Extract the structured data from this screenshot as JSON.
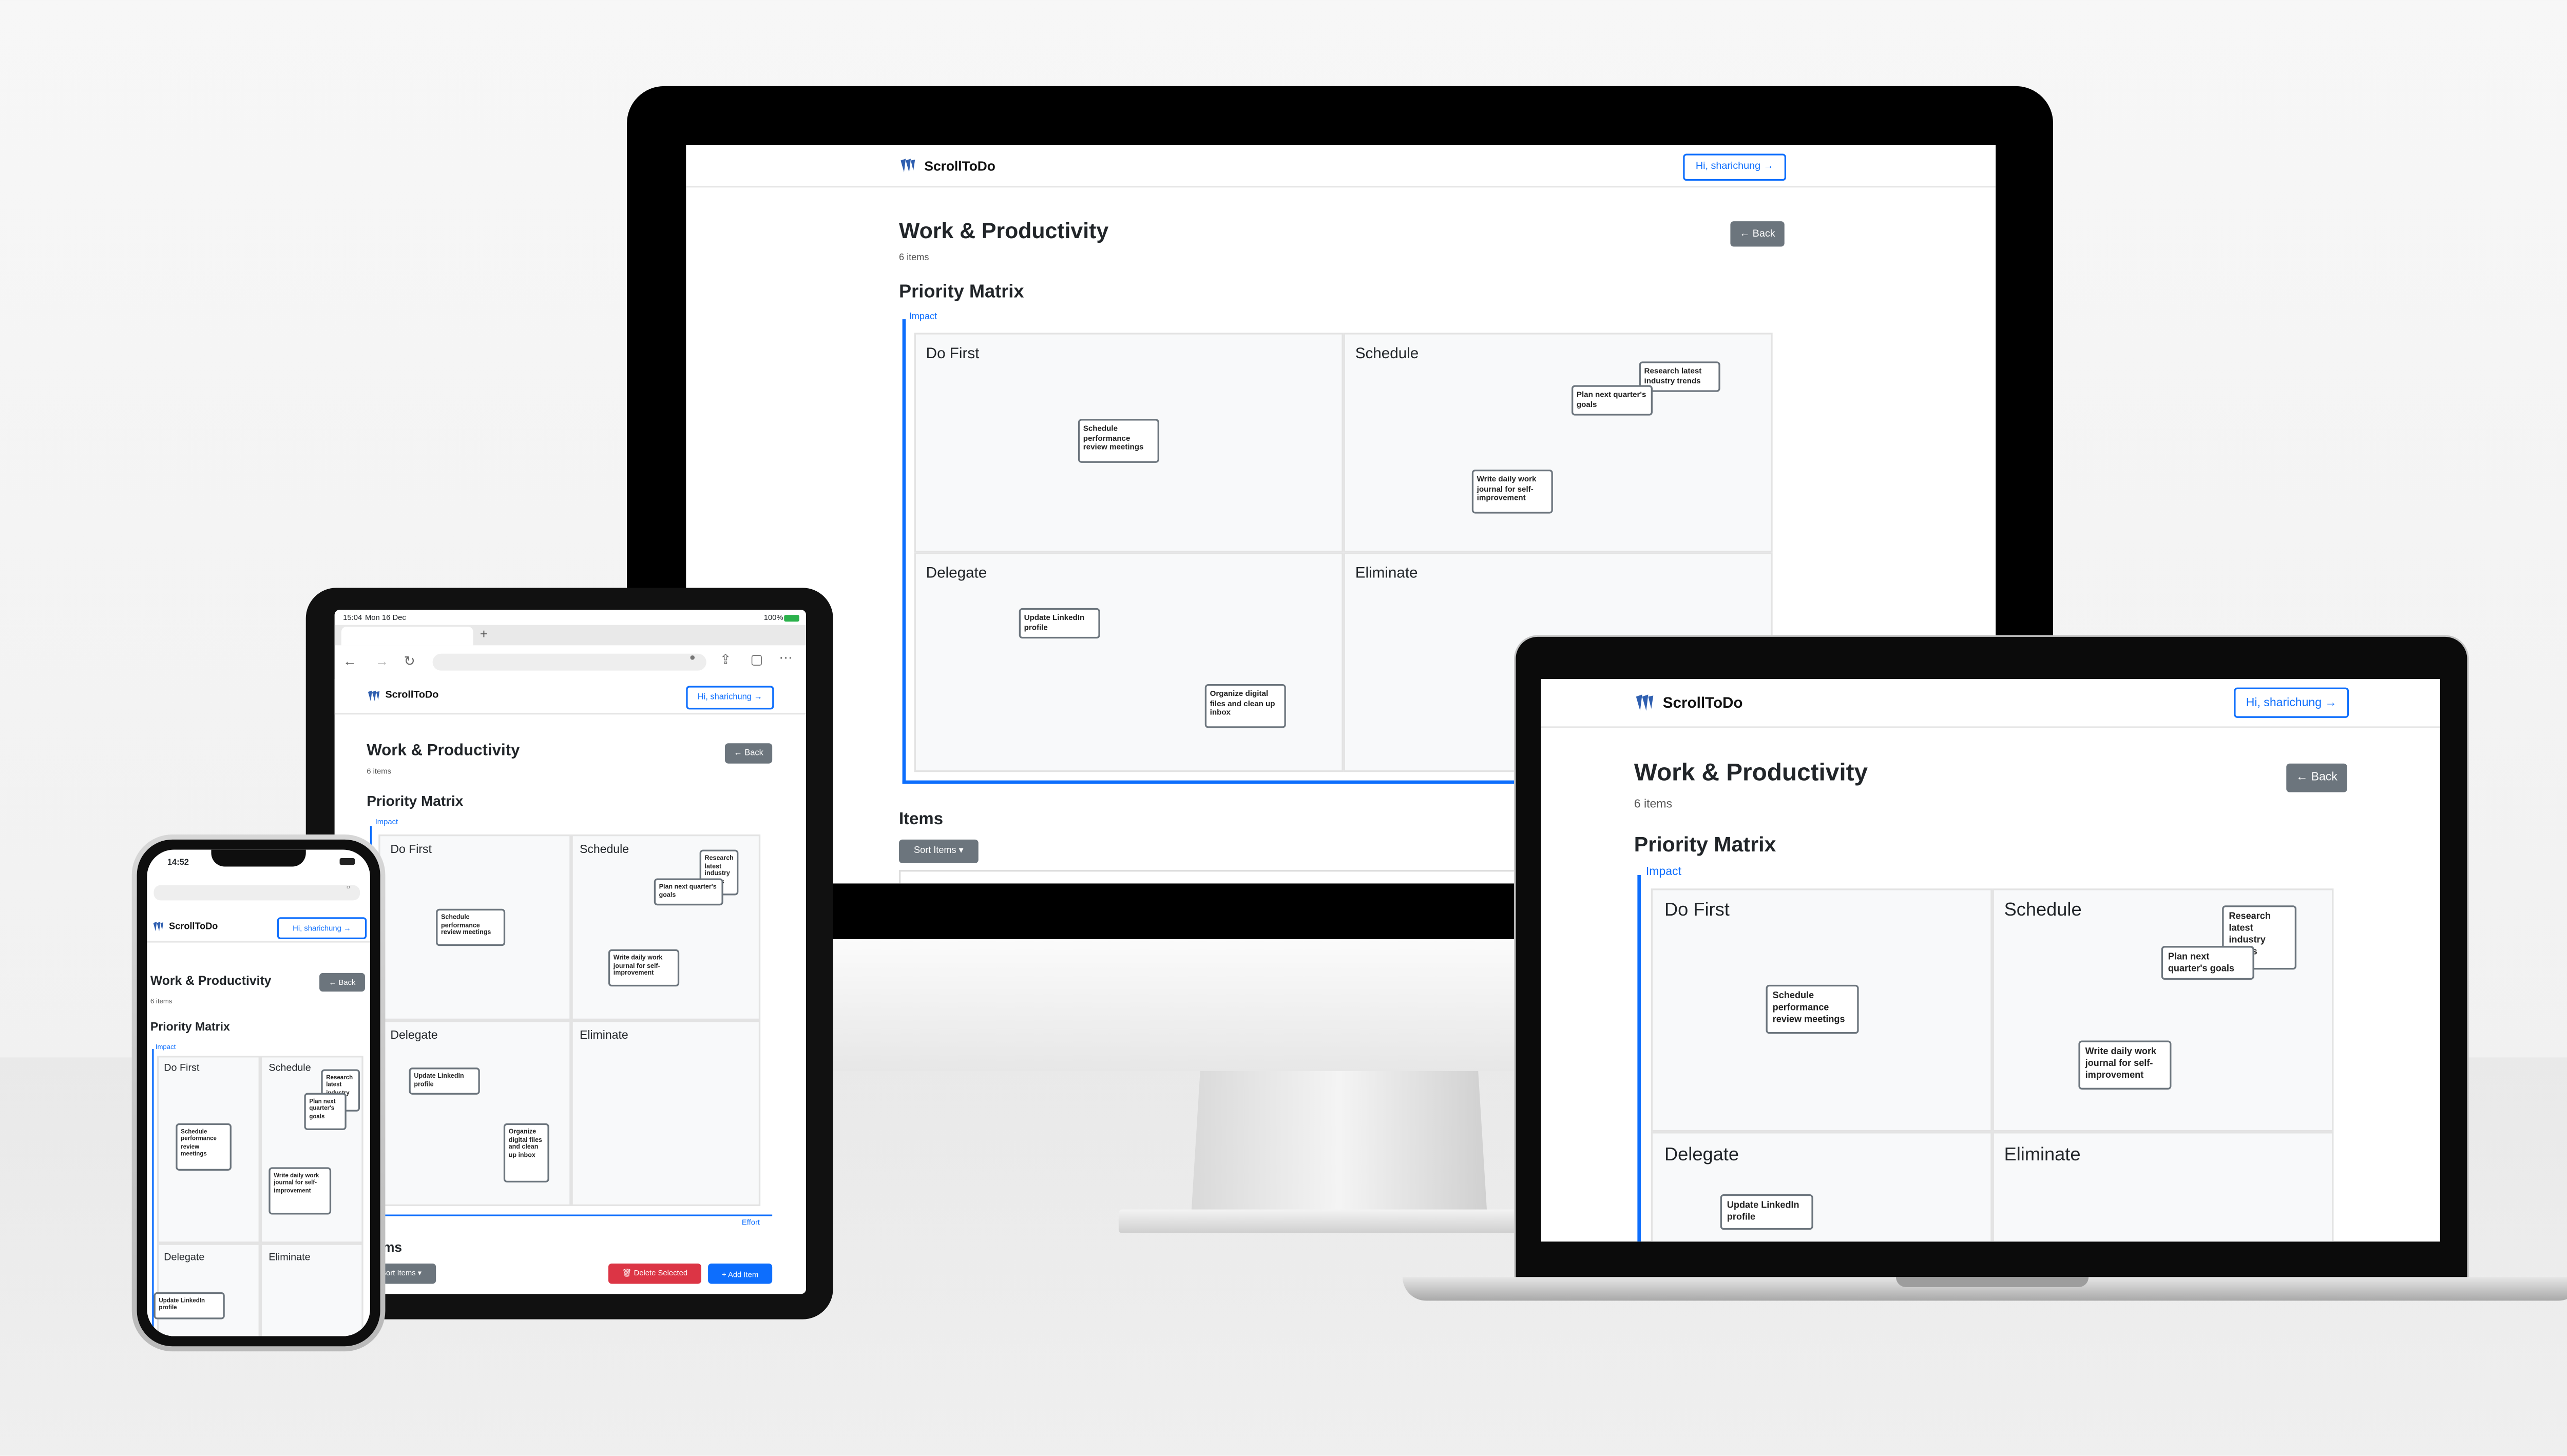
{
  "app": {
    "brand": "ScrollToDo",
    "user_button": "Hi, sharichung →",
    "page_title": "Work & Productivity",
    "item_count": "6 items",
    "back_button": "← Back",
    "matrix_title": "Priority Matrix",
    "axis_y": "Impact",
    "axis_x": "Effort",
    "quadrants": {
      "do_first": "Do First",
      "schedule": "Schedule",
      "delegate": "Delegate",
      "eliminate": "Eliminate"
    },
    "tasks": {
      "schedule_meetings": "Schedule performance review meetings",
      "research_trends": "Research latest industry trends",
      "plan_goals": "Plan next quarter's goals",
      "daily_journal": "Write daily work journal for self-improvement",
      "linkedin": "Update LinkedIn profile",
      "organize_files": "Organize digital files and clean up inbox"
    },
    "items_heading": "Items",
    "sort_button": "Sort Items ▾",
    "delete_button": "🗑 Delete Selected",
    "add_button": "+ Add Item"
  },
  "tablet_status": {
    "time": "15:04",
    "date": "Mon 16 Dec",
    "battery": "100%"
  },
  "phone_status": {
    "time": "14:52"
  },
  "colors": {
    "accent": "#0d6efd",
    "secondary": "#6c757d",
    "danger": "#dc3545",
    "quadrant_bg": "#f8f9fa"
  },
  "icons": [
    "logo-icon",
    "share-icon",
    "tabs-icon",
    "more-icon",
    "back-arrow-icon",
    "forward-arrow-icon",
    "reload-icon",
    "mic-icon",
    "plus-icon",
    "lock-icon"
  ]
}
